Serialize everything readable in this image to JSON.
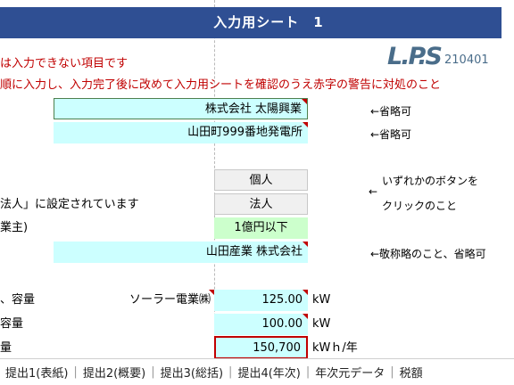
{
  "header": {
    "title": "入力用シート　1"
  },
  "logo": {
    "text": "L.P.S",
    "code": "210401"
  },
  "instructions": {
    "line1": "は入力できない項目です",
    "line2": "順に入力し、入力完了後に改めて入力用シートを確認のうえ赤字の警告に対処のこと"
  },
  "rows": {
    "company_name": "株式会社 太陽興業",
    "plant_name": "山田町999番地発電所",
    "btn_individual": "個人",
    "btn_corporate": "法人",
    "corp_set_text": "法人」に設定されています",
    "capital_label": "業主)",
    "capital_value": "1億円以下",
    "vendor_name": "山田産業 株式会社",
    "capacity_label": "、容量",
    "maker": "ソーラー電業㈱",
    "capacity_value": "125.00",
    "capacity_unit": "kW",
    "capacity2_label": "容量",
    "capacity2_value": "100.00",
    "capacity2_unit": "kW",
    "generation_label": "量",
    "generation_value": "150,700",
    "generation_unit": "kWｈ/年"
  },
  "notes": {
    "omit1": "←省略可",
    "omit2": "←省略可",
    "choose1": "いずれかのボタンを",
    "choose_arrow": "←",
    "choose2": "クリックのこと",
    "honorific": "←敬称略のこと、省略可"
  },
  "tabs": [
    "提出1(表紙)",
    "提出2(概要)",
    "提出3(総括)",
    "提出4(年次)",
    "年次元データ",
    "税額"
  ]
}
